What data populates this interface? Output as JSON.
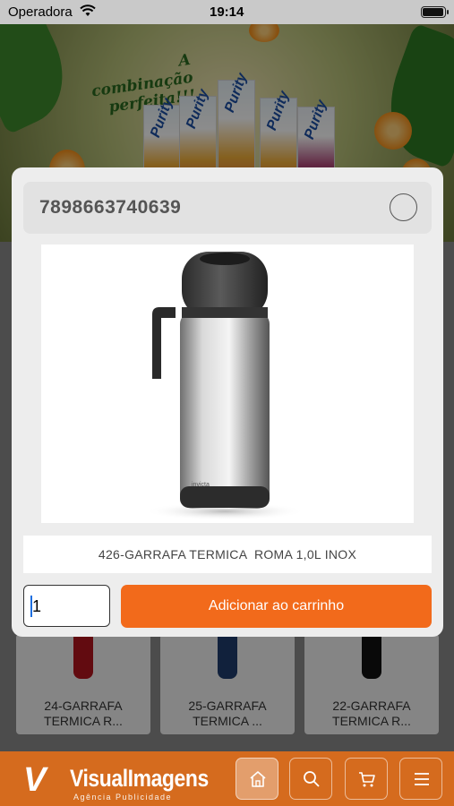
{
  "status_bar": {
    "carrier": "Operadora",
    "time": "19:14"
  },
  "banner": {
    "tagline": "A combinação perfeita!!!",
    "brand": "Purity"
  },
  "product_grid": [
    {
      "name_line1": "24-GARRAFA",
      "name_line2": "TERMICA R...",
      "color": "#b3141e"
    },
    {
      "name_line1": "25-GARRAFA",
      "name_line2": "TERMICA ...",
      "color": "#1f3d6e"
    },
    {
      "name_line1": "22-GARRAFA",
      "name_line2": "TERMICA R...",
      "color": "#111111"
    }
  ],
  "modal": {
    "barcode": "7898663740639",
    "product_description": "426-GARRAFA TERMICA  ROMA 1,0L INOX",
    "quantity": "1",
    "add_to_cart_label": "Adicionar ao carrinho"
  },
  "bottom_nav": {
    "logo_text": "VisualImagens",
    "logo_subtext": "Agência Publicidade",
    "buttons": [
      {
        "icon": "home-icon",
        "active": true
      },
      {
        "icon": "search-icon",
        "active": false
      },
      {
        "icon": "cart-icon",
        "active": false
      },
      {
        "icon": "menu-icon",
        "active": false
      }
    ]
  },
  "colors": {
    "accent": "#f26a1b",
    "nav_background": "#d56b1e"
  }
}
